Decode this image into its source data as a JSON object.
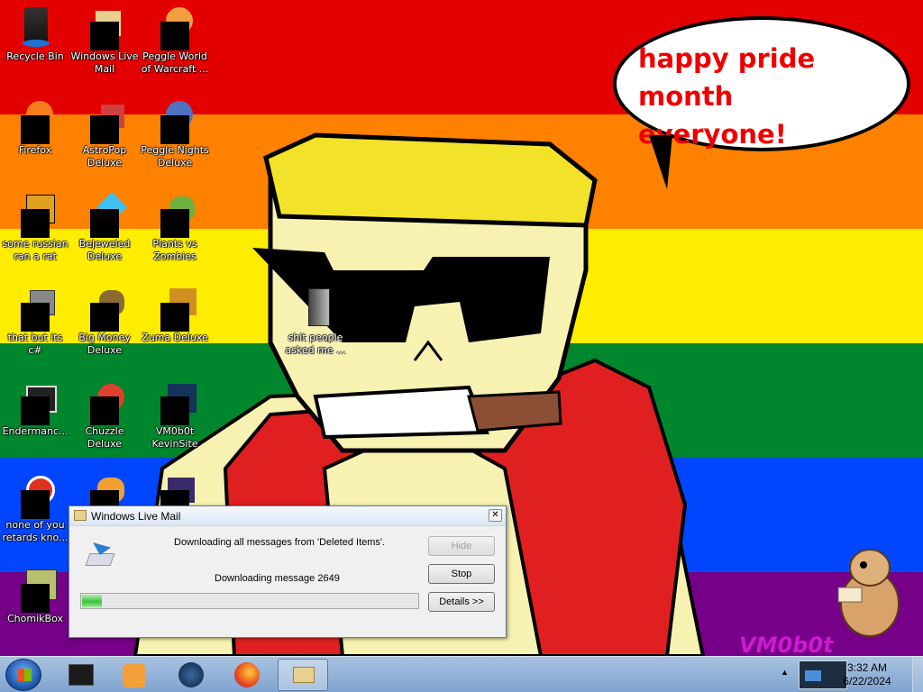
{
  "desktop_icons": [
    {
      "label": "Recycle Bin",
      "icon": "recycle-bin-icon"
    },
    {
      "label": "Windows Live Mail",
      "icon": "windows-live-mail-icon"
    },
    {
      "label": "Peggle World of Warcraft ...",
      "icon": "peggle-wow-icon"
    },
    {
      "label": "Firefox",
      "icon": "firefox-icon"
    },
    {
      "label": "AstroPop Deluxe",
      "icon": "astropop-icon"
    },
    {
      "label": "Peggle Nights Deluxe",
      "icon": "peggle-nights-icon"
    },
    {
      "label": "some russian ran a rat",
      "icon": "russian-rat-icon"
    },
    {
      "label": "Bejeweled Deluxe",
      "icon": "bejeweled-icon"
    },
    {
      "label": "Plants vs Zombies",
      "icon": "plants-vs-zombies-icon"
    },
    {
      "label": "that but its c#",
      "icon": "c-sharp-icon"
    },
    {
      "label": "Big Money Deluxe",
      "icon": "big-money-icon"
    },
    {
      "label": "Zuma Deluxe",
      "icon": "zuma-icon"
    },
    {
      "label": "Endermanc...",
      "icon": "endermanch-icon"
    },
    {
      "label": "Chuzzle Deluxe",
      "icon": "chuzzle-icon"
    },
    {
      "label": "VM0b0t KevinSite",
      "icon": "vm0b0t-icon"
    },
    {
      "label": "none of you retards kno...",
      "icon": "chrome-like-icon"
    },
    {
      "label": "ChomikBox",
      "icon": "chomikbox-icon"
    },
    {
      "label": "shit people asked me ...",
      "icon": "folder-icon"
    }
  ],
  "bubble": {
    "line1": "happy pride month",
    "line2": "everyone!"
  },
  "watermark": "VM0b0t",
  "dialog": {
    "title": "Windows Live Mail",
    "status": "Downloading all messages from 'Deleted Items'.",
    "detail": "Downloading message 2649",
    "progress": 0.06,
    "hide_label": "Hide",
    "stop_label": "Stop",
    "details_label": "Details >>"
  },
  "taskbar": {
    "time": "3:32 AM",
    "date": "6/22/2024"
  },
  "colors": {
    "red": "#e30000",
    "orange": "#ff8100",
    "yellow": "#ffed00",
    "green": "#00862c",
    "blue": "#0046ff",
    "purple": "#760088"
  }
}
